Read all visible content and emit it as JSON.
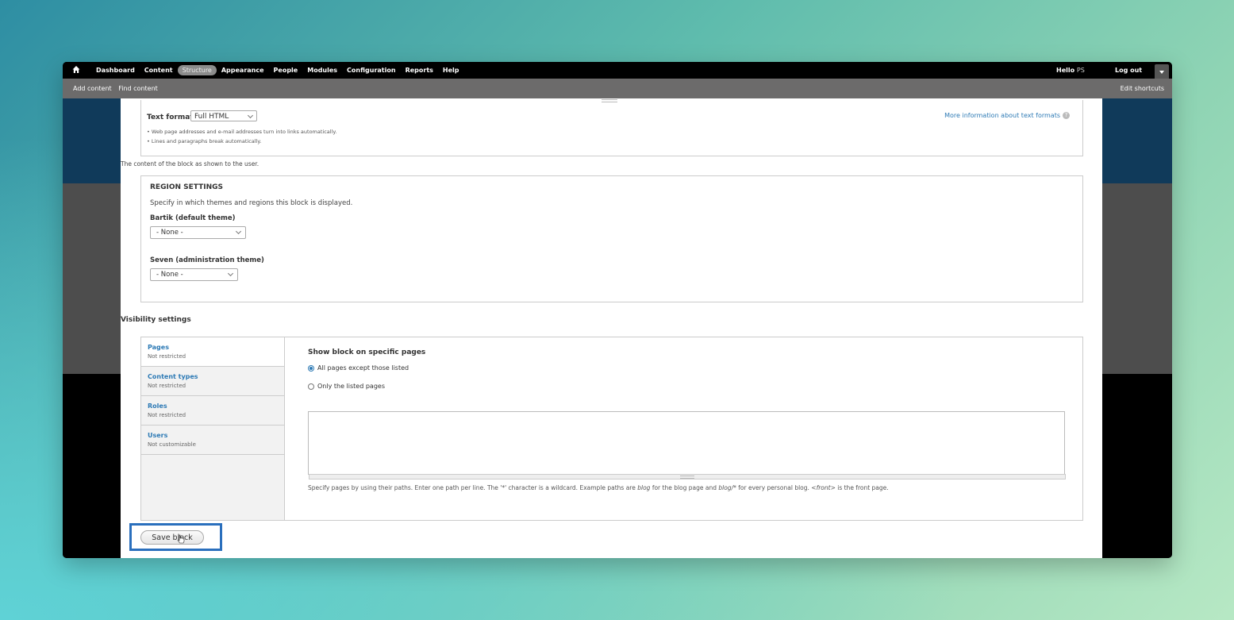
{
  "toolbar": {
    "nav": [
      "Dashboard",
      "Content",
      "Structure",
      "Appearance",
      "People",
      "Modules",
      "Configuration",
      "Reports",
      "Help"
    ],
    "active": "Structure",
    "hello_label": "Hello",
    "hello_user": "PS",
    "logout_label": "Log out",
    "home_icon": "home-icon"
  },
  "shortcuts": {
    "items": [
      "Add content",
      "Find content"
    ],
    "edit_label": "Edit shortcuts"
  },
  "text_format": {
    "label": "Text format",
    "selected": "Full HTML",
    "tips": [
      "Web page addresses and e-mail addresses turn into links automatically.",
      "Lines and paragraphs break automatically."
    ],
    "more_link": "More information about text formats"
  },
  "content_description": "The content of the block as shown to the user.",
  "region_settings": {
    "title": "REGION SETTINGS",
    "description": "Specify in which themes and regions this block is displayed.",
    "themes": [
      {
        "label": "Bartik (default theme)",
        "selected": "- None -"
      },
      {
        "label": "Seven (administration theme)",
        "selected": "- None -"
      }
    ]
  },
  "visibility": {
    "title": "Visibility settings",
    "tabs": [
      {
        "title": "Pages",
        "summary": "Not restricted"
      },
      {
        "title": "Content types",
        "summary": "Not restricted"
      },
      {
        "title": "Roles",
        "summary": "Not restricted"
      },
      {
        "title": "Users",
        "summary": "Not customizable"
      }
    ],
    "pane_title": "Show block on specific pages",
    "options": [
      "All pages except those listed",
      "Only the listed pages"
    ],
    "selected_option": "All pages except those listed",
    "pages_value": "",
    "help": {
      "p1": "Specify pages by using their paths. Enter one path per line. The '*' character is a wildcard. Example paths are ",
      "blog": "blog",
      "p2": " for the blog page and ",
      "blog_star": "blog/*",
      "p3": " for every personal blog. ",
      "front": "<front>",
      "p4": " is the front page."
    }
  },
  "save_button_label": "Save block",
  "colors": {
    "link": "#2d7ab5",
    "highlight": "#2a6fbd",
    "toolbar": "#000000",
    "shortcut_bar": "#6c6b6b"
  }
}
